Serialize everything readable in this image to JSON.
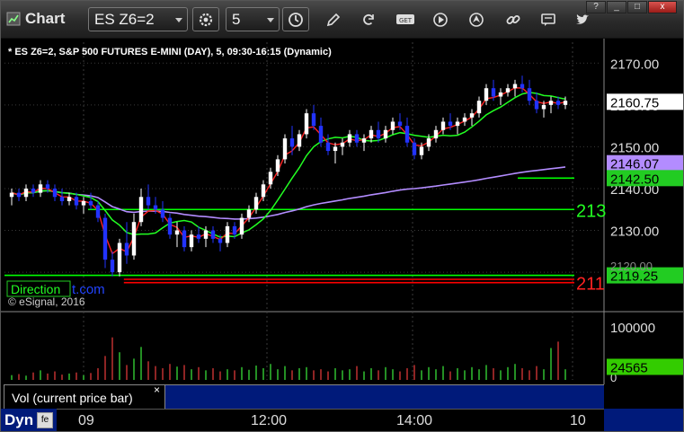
{
  "toolbar": {
    "title": "Chart",
    "symbol": "ES Z6=2",
    "interval": "5",
    "icons": [
      "chart-logo-icon",
      "settings-gear-icon",
      "clock-icon",
      "pencil-draw-icon",
      "refresh-icon",
      "get-data-icon",
      "play-icon",
      "navigation-icon",
      "link-icon",
      "message-icon",
      "twitter-bird-icon"
    ],
    "window_buttons": [
      "?",
      "_",
      "□",
      "x"
    ]
  },
  "chart_header": "* ES Z6=2, S&P 500 FUTURES E-MINI (DAY), 5, 09:30-16:15 (Dynamic)",
  "copyright": "© eSignal, 2016",
  "direction_label": "Direction",
  "watermark": "t.com",
  "volume_tab": {
    "label": "Vol (current price bar)",
    "close": "×"
  },
  "bottom": {
    "mode": "Dyn",
    "icon_label": "fe"
  },
  "colors": {
    "background": "#000000",
    "grid": "#3a3a3a",
    "up_candle": "#ffffff",
    "down_candle": "#2233ff",
    "ema_fast": "#ff2222",
    "ema_green": "#22ff22",
    "vwap": "#b38cff",
    "line_green": "#00ff00",
    "line_red": "#ff0000",
    "vol_up": "#33cc33",
    "vol_down": "#cc3333",
    "panel_blue": "#001a7a"
  },
  "chart_data": {
    "type": "candlestick",
    "title": "* ES Z6=2, S&P 500 FUTURES E-MINI (DAY), 5, 09:30-16:15 (Dynamic)",
    "ylim": [
      2111,
      2175
    ],
    "price_ticks": [
      "2170.00",
      "2160.00",
      "2150.00",
      "2140.00",
      "2130.00"
    ],
    "time_labels": [
      "09",
      "12:00",
      "14:00",
      "10"
    ],
    "price_badges": [
      {
        "label": "2160.75",
        "value": 2160.75,
        "bg": "#ffffff",
        "fg": "#000000"
      },
      {
        "label": "2146.07",
        "value": 2146.07,
        "bg": "#b38cff",
        "fg": "#000000"
      },
      {
        "label": "2142.50",
        "value": 2142.5,
        "bg": "#22cc22",
        "fg": "#000000"
      },
      {
        "label": "2119.25",
        "value": 2119.25,
        "bg": "#22cc22",
        "fg": "#000000"
      }
    ],
    "side_labels": [
      {
        "label": "213",
        "value": 2135,
        "color": "#22ff22"
      },
      {
        "label": "211",
        "value": 2117.5,
        "color": "#ff2222"
      }
    ],
    "hidden_tick_labels": [
      "2120.00"
    ],
    "horizontal_lines": [
      {
        "value": 2135,
        "color": "#00ff00",
        "from": 0.14
      },
      {
        "value": 2142.5,
        "color": "#00ff00",
        "from": 0.86
      },
      {
        "value": 2119.25,
        "color": "#00ff00",
        "from": 0.0
      },
      {
        "value": 2117.5,
        "color": "#ff0000",
        "from": 0.2
      },
      {
        "value": 2118.3,
        "color": "#ff0000",
        "from": 0.2
      }
    ],
    "candles": [
      [
        2138,
        2140,
        2136,
        2139
      ],
      [
        2139,
        2140,
        2137,
        2138
      ],
      [
        2138,
        2141,
        2137,
        2140
      ],
      [
        2140,
        2141,
        2138,
        2139
      ],
      [
        2139,
        2142,
        2138,
        2141
      ],
      [
        2141,
        2142,
        2139,
        2140
      ],
      [
        2140,
        2141,
        2137,
        2138
      ],
      [
        2138,
        2140,
        2136,
        2137
      ],
      [
        2137,
        2139,
        2136,
        2138
      ],
      [
        2138,
        2139,
        2135,
        2136
      ],
      [
        2136,
        2138,
        2134,
        2137
      ],
      [
        2137,
        2139,
        2135,
        2136
      ],
      [
        2136,
        2137,
        2132,
        2133
      ],
      [
        2133,
        2134,
        2121,
        2123
      ],
      [
        2123,
        2125,
        2119,
        2120
      ],
      [
        2120,
        2128,
        2119,
        2127
      ],
      [
        2127,
        2132,
        2122,
        2124
      ],
      [
        2124,
        2134,
        2123,
        2132
      ],
      [
        2132,
        2140,
        2131,
        2138
      ],
      [
        2138,
        2141,
        2135,
        2136
      ],
      [
        2136,
        2138,
        2134,
        2135
      ],
      [
        2135,
        2137,
        2132,
        2133
      ],
      [
        2133,
        2134,
        2128,
        2129
      ],
      [
        2129,
        2132,
        2126,
        2130
      ],
      [
        2130,
        2131,
        2125,
        2126
      ],
      [
        2126,
        2130,
        2125,
        2129
      ],
      [
        2129,
        2131,
        2127,
        2128
      ],
      [
        2128,
        2131,
        2126,
        2130
      ],
      [
        2130,
        2131,
        2127,
        2128
      ],
      [
        2128,
        2129,
        2125,
        2127
      ],
      [
        2127,
        2132,
        2126,
        2131
      ],
      [
        2131,
        2132,
        2128,
        2129
      ],
      [
        2129,
        2134,
        2128,
        2133
      ],
      [
        2133,
        2136,
        2132,
        2135
      ],
      [
        2135,
        2139,
        2134,
        2138
      ],
      [
        2138,
        2142,
        2137,
        2141
      ],
      [
        2141,
        2145,
        2140,
        2144
      ],
      [
        2144,
        2148,
        2143,
        2147
      ],
      [
        2147,
        2153,
        2146,
        2152
      ],
      [
        2152,
        2155,
        2148,
        2150
      ],
      [
        2150,
        2154,
        2149,
        2153
      ],
      [
        2153,
        2159,
        2152,
        2158
      ],
      [
        2158,
        2160,
        2154,
        2155
      ],
      [
        2155,
        2157,
        2150,
        2151
      ],
      [
        2151,
        2153,
        2148,
        2149
      ],
      [
        2149,
        2151,
        2146,
        2150
      ],
      [
        2150,
        2152,
        2148,
        2151
      ],
      [
        2151,
        2154,
        2150,
        2153
      ],
      [
        2153,
        2154,
        2150,
        2151
      ],
      [
        2151,
        2153,
        2149,
        2152
      ],
      [
        2152,
        2155,
        2151,
        2154
      ],
      [
        2154,
        2156,
        2151,
        2152
      ],
      [
        2152,
        2155,
        2151,
        2154
      ],
      [
        2154,
        2157,
        2153,
        2156
      ],
      [
        2156,
        2158,
        2154,
        2155
      ],
      [
        2155,
        2157,
        2150,
        2151
      ],
      [
        2151,
        2152,
        2147,
        2148
      ],
      [
        2148,
        2151,
        2147,
        2150
      ],
      [
        2150,
        2153,
        2149,
        2152
      ],
      [
        2152,
        2155,
        2151,
        2154
      ],
      [
        2154,
        2157,
        2153,
        2156
      ],
      [
        2156,
        2158,
        2154,
        2155
      ],
      [
        2155,
        2157,
        2153,
        2156
      ],
      [
        2156,
        2158,
        2155,
        2157
      ],
      [
        2157,
        2159,
        2155,
        2158
      ],
      [
        2158,
        2162,
        2157,
        2161
      ],
      [
        2161,
        2165,
        2160,
        2164
      ],
      [
        2164,
        2166,
        2161,
        2162
      ],
      [
        2162,
        2164,
        2160,
        2163
      ],
      [
        2163,
        2165,
        2162,
        2164
      ],
      [
        2164,
        2166,
        2162,
        2165
      ],
      [
        2165,
        2167,
        2163,
        2164
      ],
      [
        2164,
        2166,
        2160,
        2161
      ],
      [
        2161,
        2163,
        2158,
        2159
      ],
      [
        2159,
        2161,
        2157,
        2160
      ],
      [
        2160,
        2162,
        2158,
        2161
      ],
      [
        2161,
        2162,
        2159,
        2160
      ],
      [
        2160,
        2162,
        2159,
        2161
      ]
    ],
    "volume": [
      9,
      11,
      8,
      14,
      18,
      12,
      16,
      10,
      12,
      14,
      9,
      13,
      22,
      45,
      80,
      52,
      28,
      40,
      62,
      35,
      26,
      22,
      30,
      25,
      28,
      20,
      24,
      18,
      22,
      16,
      20,
      18,
      24,
      19,
      27,
      22,
      30,
      20,
      26,
      18,
      22,
      24,
      18,
      20,
      16,
      22,
      18,
      20,
      26,
      16,
      22,
      18,
      24,
      20,
      16,
      22,
      28,
      18,
      24,
      20,
      26,
      16,
      22,
      18,
      24,
      20,
      28,
      22,
      18,
      24,
      30,
      22,
      18,
      26,
      20,
      60,
      72,
      20
    ],
    "volume_ticks": [
      "100000",
      "0"
    ],
    "volume_badge": {
      "label": "24565",
      "value": 24565
    },
    "volume_ylim": [
      0,
      125000
    ]
  }
}
